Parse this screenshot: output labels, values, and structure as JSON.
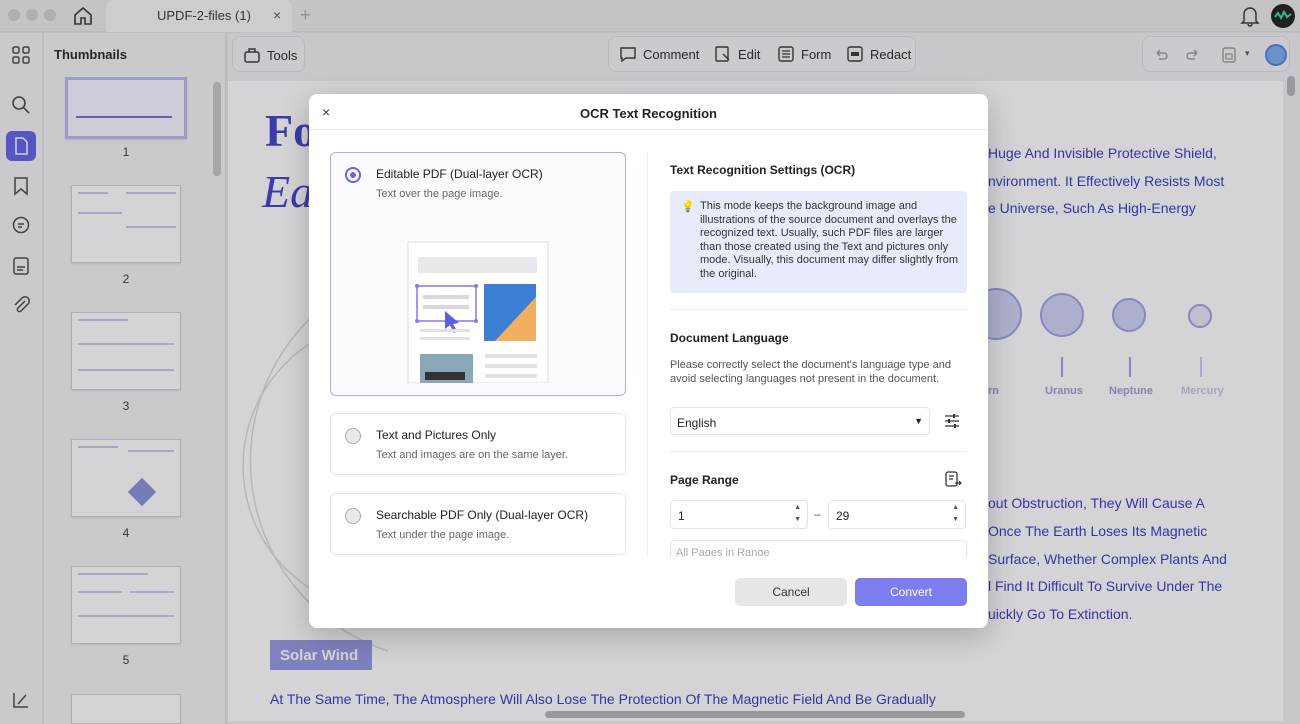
{
  "tab": {
    "title": "UPDF-2-files (1)",
    "close": "×",
    "add": "+"
  },
  "sidebar": {
    "title": "Thumbnails",
    "pages": [
      "1",
      "2",
      "3",
      "4",
      "5"
    ]
  },
  "toolbar": {
    "tools": "Tools",
    "comment": "Comment",
    "edit": "Edit",
    "form": "Form",
    "redact": "Redact"
  },
  "doc": {
    "big_title_1": "Fo",
    "big_title_2": "Ea",
    "lines_top": [
      "Huge And Invisible Protective Shield,",
      "nvironment. It Effectively Resists Most",
      "e Universe, Such As High-Energy"
    ],
    "planets": [
      "rn",
      "Uranus",
      "Neptune",
      "Mercury"
    ],
    "lines_mid": [
      "out Obstruction, They Will Cause A",
      "Once The Earth Loses Its Magnetic",
      "Surface, Whether Complex Plants And",
      "l Find It Difficult To Survive Under The",
      "uickly Go To Extinction."
    ],
    "section": "Solar Wind",
    "bottom_line": "At The Same Time, The Atmosphere Will Also Lose The Protection Of The Magnetic Field And Be Gradually"
  },
  "dialog": {
    "title": "OCR Text Recognition",
    "close": "×",
    "options": [
      {
        "title": "Editable PDF (Dual-layer OCR)",
        "subtitle": "Text over the page image.",
        "selected": true
      },
      {
        "title": "Text and Pictures Only",
        "subtitle": "Text and images are on the same layer.",
        "selected": false
      },
      {
        "title": "Searchable PDF Only (Dual-layer OCR)",
        "subtitle": "Text under the page image.",
        "selected": false
      }
    ],
    "settings_heading": "Text Recognition Settings (OCR)",
    "settings_note": "This mode keeps the background image and illustrations of the source document and overlays the recognized text. Usually, such PDF files are larger than those created using the Text and pictures only mode. Visually, this document may differ slightly from the original.",
    "language_heading": "Document Language",
    "language_desc": "Please correctly select the document's language type and avoid selecting languages not present in the document.",
    "language_value": "English",
    "page_range_heading": "Page Range",
    "range_from": "1",
    "range_to": "29",
    "range_dash": "–",
    "range_select": "All Pages in Range",
    "cancel": "Cancel",
    "convert": "Convert"
  },
  "colors": {
    "accent": "#6366e8",
    "convert": "#7c7ef0",
    "doc_text": "#3232c0"
  }
}
